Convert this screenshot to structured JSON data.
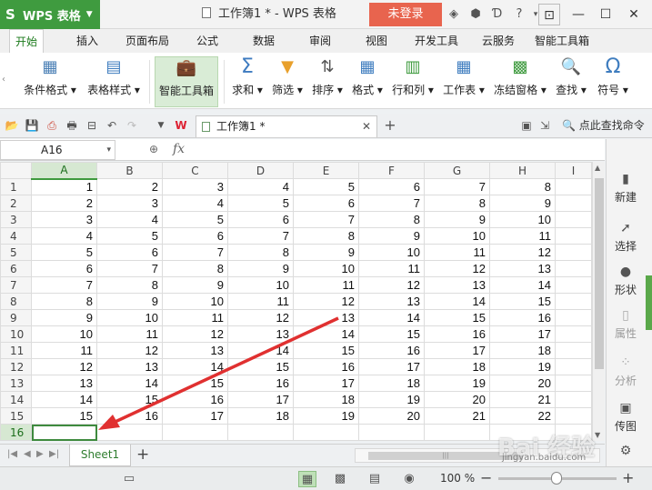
{
  "titlebar": {
    "app_name": "WPS 表格",
    "window_title": "工作簿1 * - WPS 表格",
    "login_label": "未登录",
    "help_label": "?"
  },
  "menu": {
    "tabs": [
      "开始",
      "插入",
      "页面布局",
      "公式",
      "数据",
      "审阅",
      "视图",
      "开发工具",
      "云服务",
      "智能工具箱"
    ],
    "active_index": 0
  },
  "ribbon": {
    "buttons": [
      {
        "label": "条件格式 ▾",
        "icon": "conditional-format-icon"
      },
      {
        "label": "表格样式 ▾",
        "icon": "table-style-icon"
      },
      {
        "label": "智能工具箱",
        "icon": "toolbox-icon"
      },
      {
        "label": "求和 ▾",
        "icon": "sum-icon"
      },
      {
        "label": "筛选 ▾",
        "icon": "filter-icon"
      },
      {
        "label": "排序 ▾",
        "icon": "sort-icon"
      },
      {
        "label": "格式 ▾",
        "icon": "format-icon"
      },
      {
        "label": "行和列 ▾",
        "icon": "rows-columns-icon"
      },
      {
        "label": "工作表 ▾",
        "icon": "worksheet-icon"
      },
      {
        "label": "冻结窗格 ▾",
        "icon": "freeze-panes-icon"
      },
      {
        "label": "查找 ▾",
        "icon": "find-icon"
      },
      {
        "label": "符号 ▾",
        "icon": "symbol-icon"
      }
    ]
  },
  "quickbar": {
    "doc_tab_label": "工作簿1 *",
    "find_command": "点此查找命令"
  },
  "formula": {
    "name_box": "A16",
    "fx_label": "fx"
  },
  "sheet": {
    "columns": [
      "A",
      "B",
      "C",
      "D",
      "E",
      "F",
      "G",
      "H",
      "I"
    ],
    "selected_column": "A",
    "selected_row": 16,
    "active_cell": "A16",
    "rows": [
      {
        "n": 1,
        "cells": [
          1,
          2,
          3,
          4,
          5,
          6,
          7,
          8
        ]
      },
      {
        "n": 2,
        "cells": [
          2,
          3,
          4,
          5,
          6,
          7,
          8,
          9
        ]
      },
      {
        "n": 3,
        "cells": [
          3,
          4,
          5,
          6,
          7,
          8,
          9,
          10
        ]
      },
      {
        "n": 4,
        "cells": [
          4,
          5,
          6,
          7,
          8,
          9,
          10,
          11
        ]
      },
      {
        "n": 5,
        "cells": [
          5,
          6,
          7,
          8,
          9,
          10,
          11,
          12
        ]
      },
      {
        "n": 6,
        "cells": [
          6,
          7,
          8,
          9,
          10,
          11,
          12,
          13
        ]
      },
      {
        "n": 7,
        "cells": [
          7,
          8,
          9,
          10,
          11,
          12,
          13,
          14
        ]
      },
      {
        "n": 8,
        "cells": [
          8,
          9,
          10,
          11,
          12,
          13,
          14,
          15
        ]
      },
      {
        "n": 9,
        "cells": [
          9,
          10,
          11,
          12,
          13,
          14,
          15,
          16
        ]
      },
      {
        "n": 10,
        "cells": [
          10,
          11,
          12,
          13,
          14,
          15,
          16,
          17
        ]
      },
      {
        "n": 11,
        "cells": [
          11,
          12,
          13,
          14,
          15,
          16,
          17,
          18
        ]
      },
      {
        "n": 12,
        "cells": [
          12,
          13,
          14,
          15,
          16,
          17,
          18,
          19
        ]
      },
      {
        "n": 13,
        "cells": [
          13,
          14,
          15,
          16,
          17,
          18,
          19,
          20
        ]
      },
      {
        "n": 14,
        "cells": [
          14,
          15,
          16,
          17,
          18,
          19,
          20,
          21
        ]
      },
      {
        "n": 15,
        "cells": [
          15,
          16,
          17,
          18,
          19,
          20,
          21,
          22
        ]
      },
      {
        "n": 16,
        "cells": [
          "",
          "",
          "",
          "",
          "",
          "",
          "",
          ""
        ]
      }
    ]
  },
  "right_panel": {
    "items": [
      {
        "label": "新建",
        "icon": "new-icon",
        "enabled": true
      },
      {
        "label": "选择",
        "icon": "select-icon",
        "enabled": true
      },
      {
        "label": "形状",
        "icon": "shape-icon",
        "enabled": true
      },
      {
        "label": "属性",
        "icon": "properties-icon",
        "enabled": false
      },
      {
        "label": "分析",
        "icon": "analysis-icon",
        "enabled": false
      },
      {
        "label": "传图",
        "icon": "upload-image-icon",
        "enabled": true
      }
    ]
  },
  "sheet_tabs": {
    "tabs": [
      "Sheet1"
    ],
    "add_label": "+"
  },
  "statusbar": {
    "zoom": "100 %"
  },
  "colors": {
    "brand_green": "#3f9b3f",
    "login_red": "#e8644e",
    "arrow_red": "#e03030"
  },
  "watermark": {
    "text": "Bai 经验",
    "sub": "jingyan.baidu.com"
  }
}
